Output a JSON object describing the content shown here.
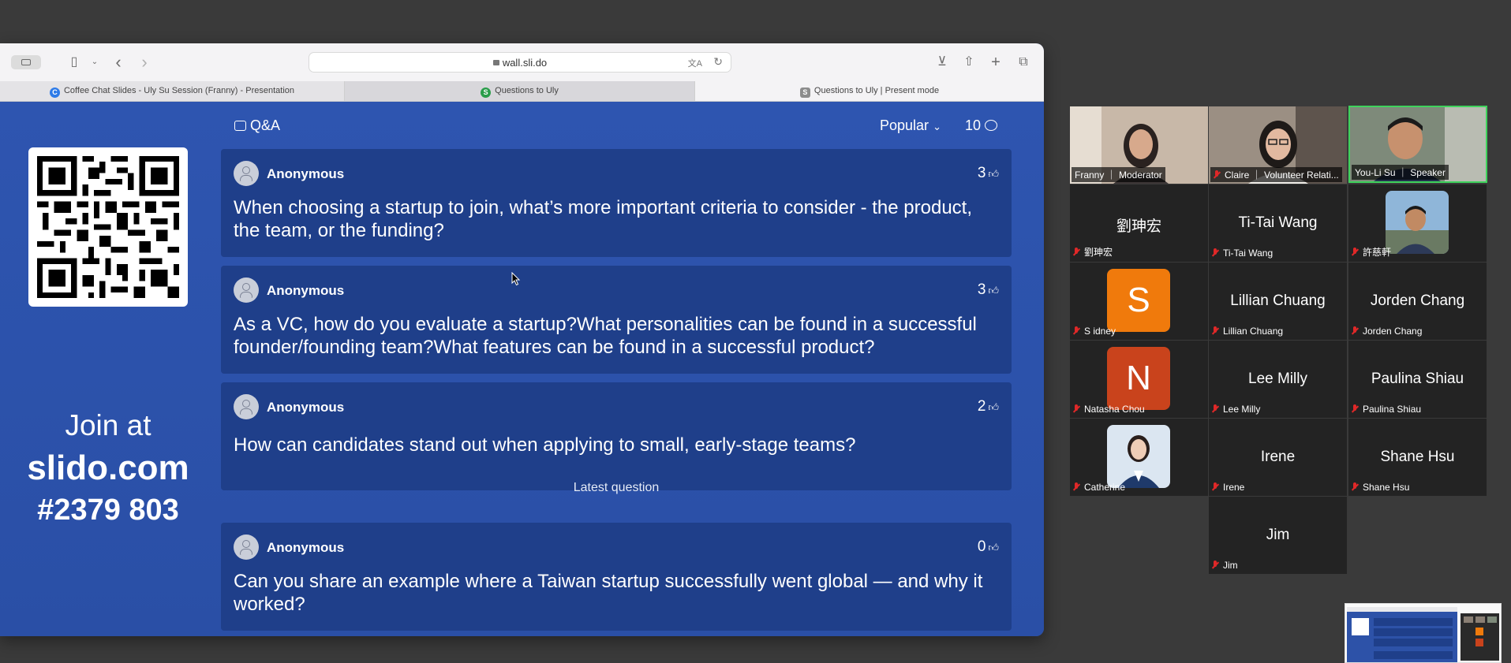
{
  "browser": {
    "url": "wall.sli.do",
    "tabs": [
      {
        "label": "Coffee Chat Slides - Uly Su Session (Franny) - Presentation",
        "favicon": "C"
      },
      {
        "label": "Questions to Uly",
        "favicon": "S"
      },
      {
        "label": "Questions to Uly | Present mode",
        "favicon": "S"
      }
    ]
  },
  "slido": {
    "section_title": "Q&A",
    "sort_label": "Popular",
    "question_count": "10",
    "join": {
      "line1": "Join at",
      "domain": "slido.com",
      "code": "#2379 803"
    },
    "latest_label": "Latest question",
    "questions": [
      {
        "author": "Anonymous",
        "votes": "3",
        "text": "When choosing a startup to join, what’s more important criteria to consider - the product, the team, or the funding?"
      },
      {
        "author": "Anonymous",
        "votes": "3",
        "text": "As a VC, how do you evaluate a startup?What personalities can be found in a successful founder/founding team?What features can be found in a successful product?"
      },
      {
        "author": "Anonymous",
        "votes": "2",
        "text": "How can candidates stand out when applying to small, early-stage teams?"
      },
      {
        "author": "Anonymous",
        "votes": "0",
        "text": "Can you share an example where a Taiwan startup successfully went global — and why it worked?"
      }
    ]
  },
  "zoom": {
    "video_tiles": [
      {
        "label": "Franny ｜ Moderator"
      },
      {
        "label": "Claire ｜ Volunteer Relati..."
      },
      {
        "label": "You-Li Su ｜ Speaker"
      }
    ],
    "participants": [
      {
        "display": "劉珅宏",
        "label": "劉珅宏"
      },
      {
        "display": "Ti-Tai Wang",
        "label": "Ti-Tai Wang"
      },
      {
        "display": "",
        "label": "許慈軒"
      },
      {
        "display": "S",
        "label": "S idney"
      },
      {
        "display": "Lillian Chuang",
        "label": "Lillian Chuang"
      },
      {
        "display": "Jorden Chang",
        "label": "Jorden Chang"
      },
      {
        "display": "N",
        "label": "Natasha Chou"
      },
      {
        "display": "Lee Milly",
        "label": "Lee Milly"
      },
      {
        "display": "Paulina Shiau",
        "label": "Paulina Shiau"
      },
      {
        "display": "",
        "label": "Catherine"
      },
      {
        "display": "Irene",
        "label": "Irene"
      },
      {
        "display": "Shane Hsu",
        "label": "Shane Hsu"
      },
      {
        "display": "Jim",
        "label": "Jim"
      }
    ],
    "colors": {
      "letter_s": "#f07a0c",
      "letter_n": "#c9431c",
      "active_speaker": "#3fd35c"
    }
  }
}
